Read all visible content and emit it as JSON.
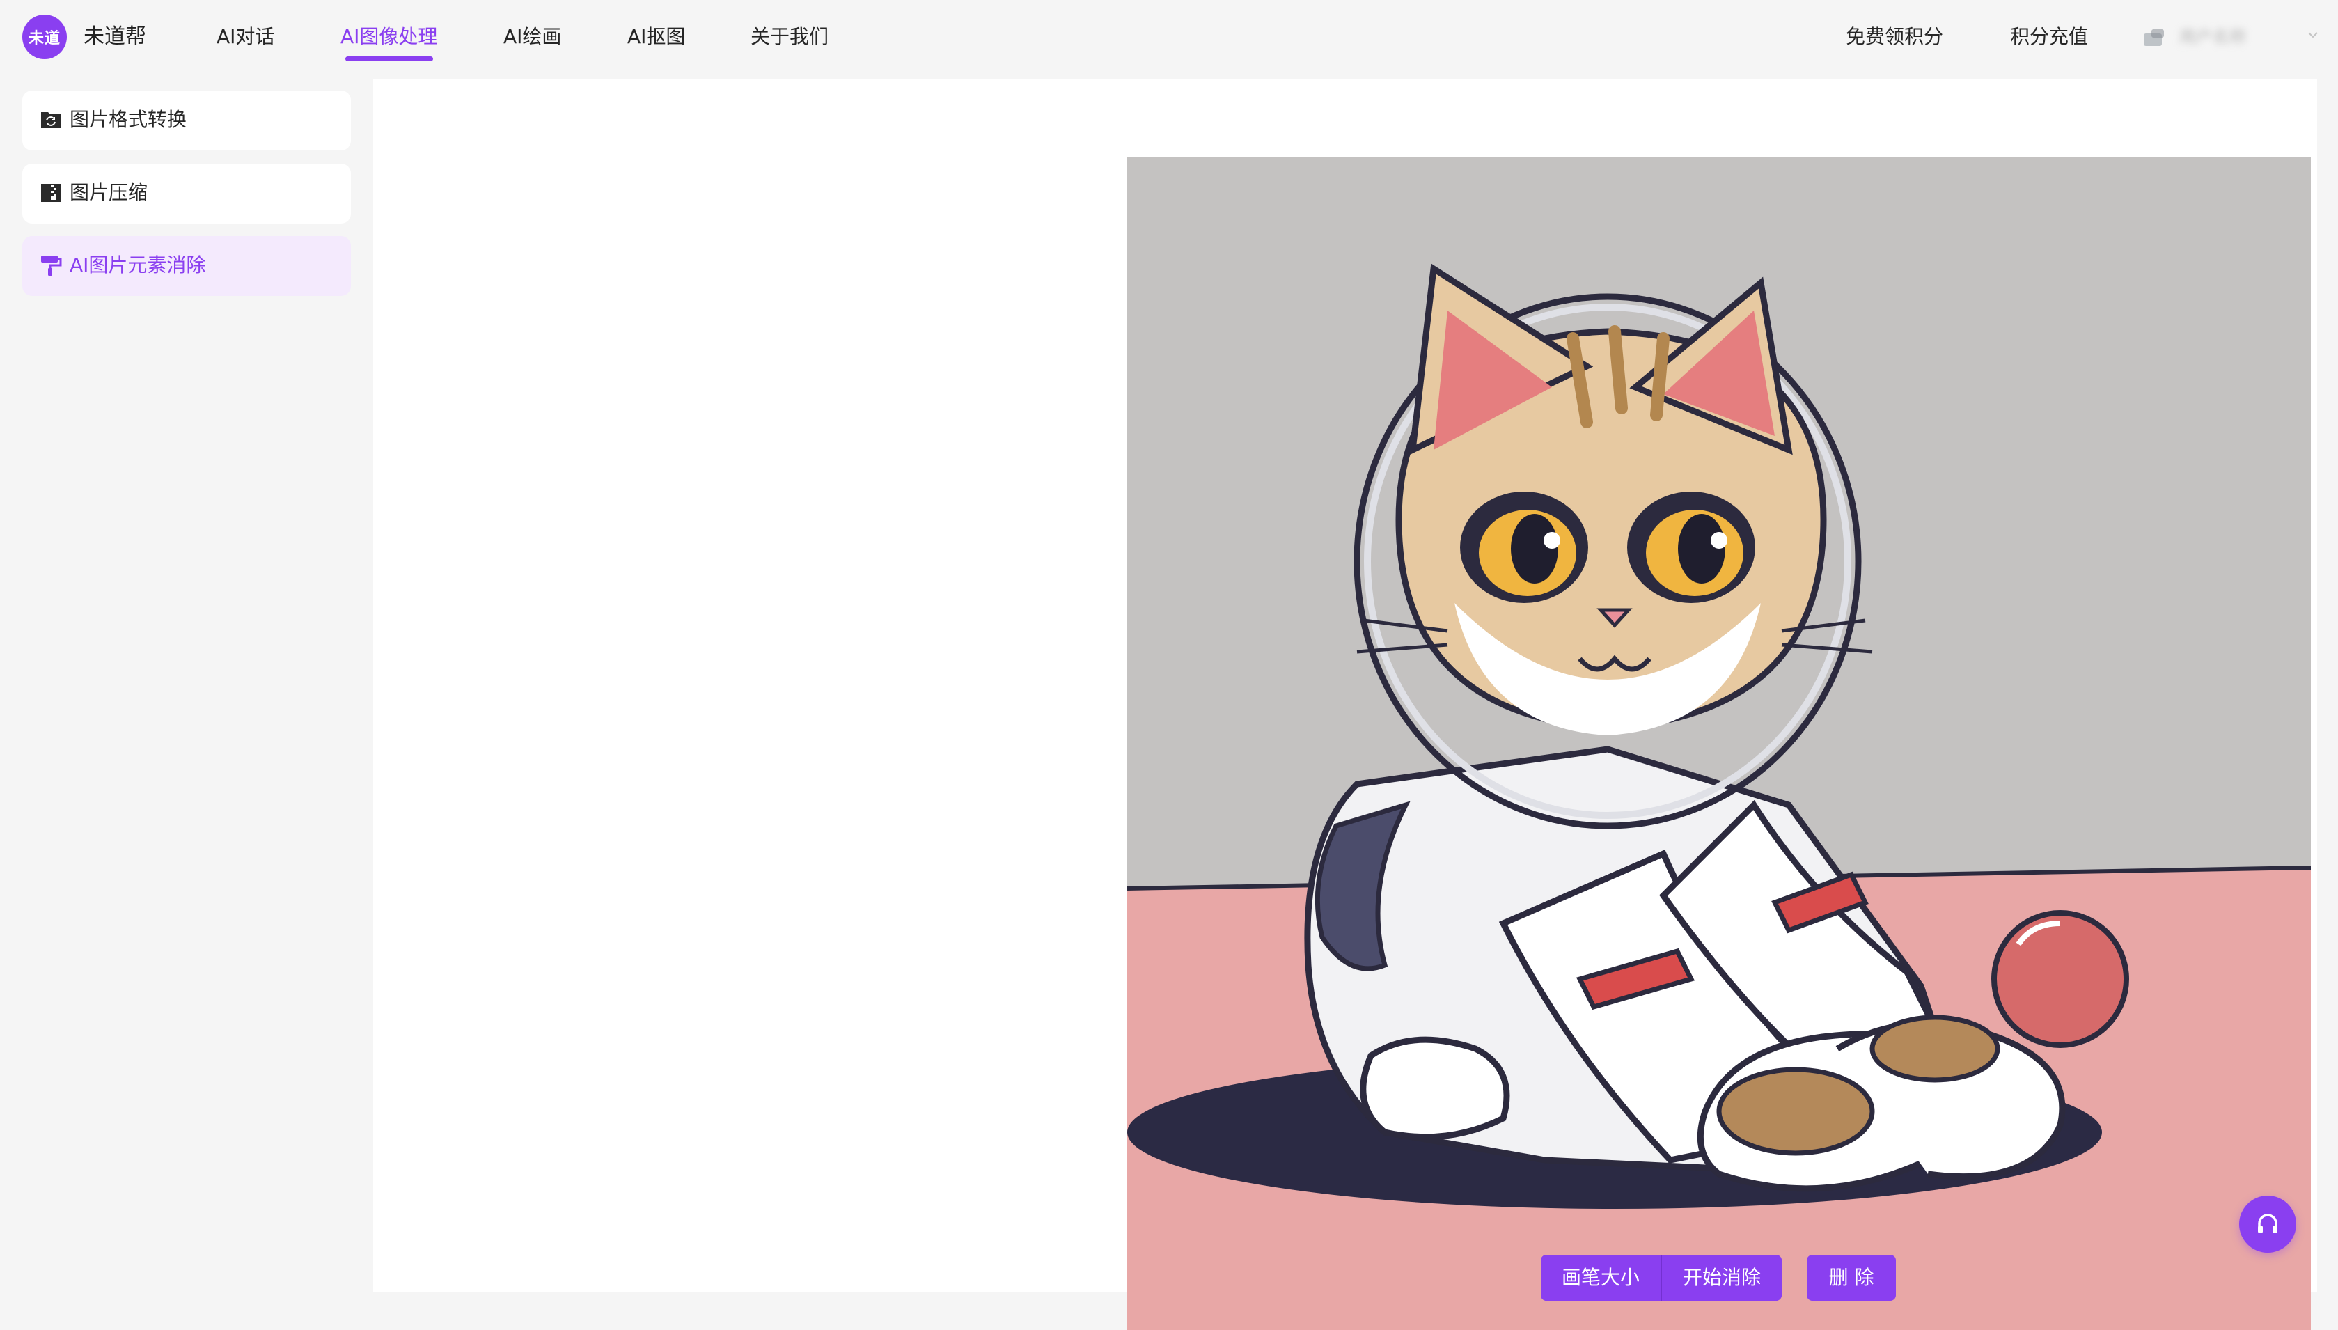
{
  "brand": {
    "logo_text": "未道",
    "name": "未道帮"
  },
  "nav": {
    "items": [
      {
        "label": "AI对话",
        "active": false
      },
      {
        "label": "AI图像处理",
        "active": true
      },
      {
        "label": "AI绘画",
        "active": false
      },
      {
        "label": "AI抠图",
        "active": false
      },
      {
        "label": "关于我们",
        "active": false
      }
    ],
    "right": [
      {
        "label": "免费领积分"
      },
      {
        "label": "积分充值"
      }
    ],
    "user": {
      "name": "用户名称",
      "obscured": true
    }
  },
  "sidebar": {
    "items": [
      {
        "label": "图片格式转换",
        "icon": "folder-sync-icon",
        "active": false
      },
      {
        "label": "图片压缩",
        "icon": "zip-file-icon",
        "active": false
      },
      {
        "label": "AI图片元素消除",
        "icon": "paint-roller-icon",
        "active": true
      }
    ]
  },
  "toolbar": {
    "brush_size_label": "画笔大小",
    "start_erase_label": "开始消除",
    "delete_label": "删 除"
  },
  "canvas": {
    "image": "cartoon cat in astronaut suit"
  },
  "colors": {
    "accent": "#8a3ff0",
    "active_bg": "#f4eafd",
    "page_bg": "#f5f5f5"
  }
}
